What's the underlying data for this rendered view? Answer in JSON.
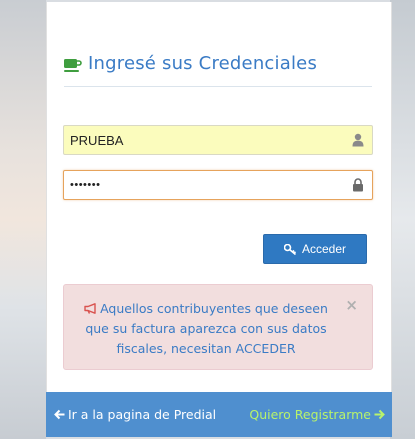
{
  "login": {
    "title": "Ingresé sus Credenciales",
    "title_icon": "coffee-icon",
    "username": {
      "value": "PRUEBA",
      "icon": "user-icon"
    },
    "password": {
      "value": "•••••••",
      "icon": "lock-icon"
    },
    "submit_label": "Acceder",
    "submit_icon": "key-icon"
  },
  "alert": {
    "icon": "megaphone-icon",
    "message": "Aquellos contribuyentes que deseen que su factura aparezca con sus datos fiscales, necesitan ACCEDER",
    "close": "×"
  },
  "footer": {
    "left_link": "Ir a la pagina de Predial",
    "right_link": "Quiero Registrarme"
  },
  "colors": {
    "accent": "#3a7bc5",
    "button": "#2f79c2",
    "footer": "#4f8fcf",
    "footer_link_alt": "#b8f36b",
    "alert_bg": "#f2dede",
    "autofill_bg": "#fbfcbd",
    "focus_border": "#e6a35c"
  }
}
